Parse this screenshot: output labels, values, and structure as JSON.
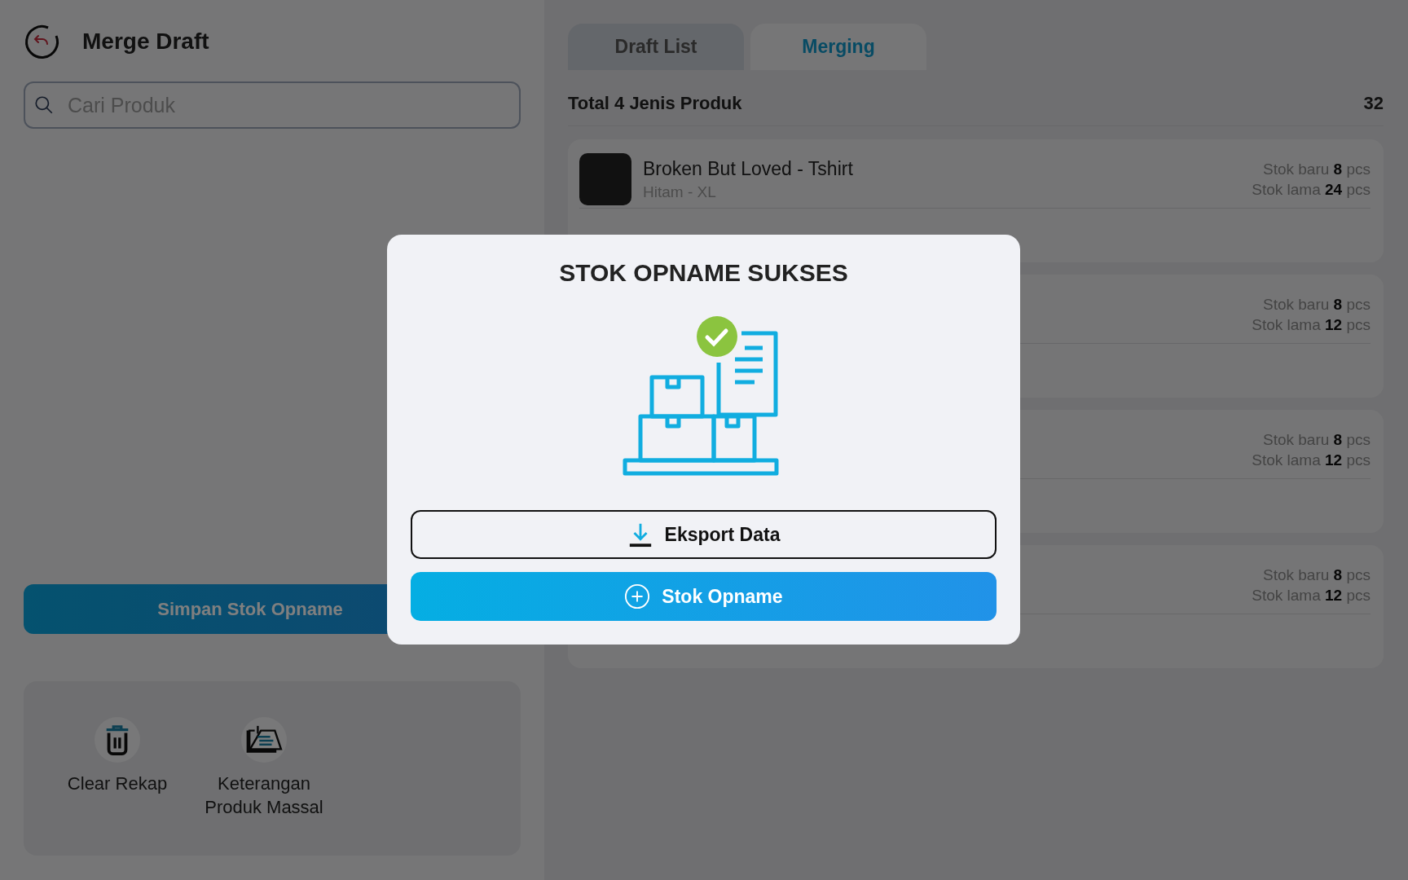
{
  "header": {
    "title": "Merge Draft"
  },
  "search": {
    "placeholder": "Cari Produk"
  },
  "save_button": "Simpan Stok Opname",
  "actions": [
    {
      "kind": "trash",
      "label": "Clear Rekap"
    },
    {
      "kind": "note",
      "label": "Keterangan Produk Massal"
    }
  ],
  "tabs": [
    {
      "label": "Draft List",
      "selected": false
    },
    {
      "label": "Merging",
      "selected": true
    }
  ],
  "summary": {
    "label": "Total 4 Jenis Produk",
    "count": "32"
  },
  "products": [
    {
      "name": "Broken But Loved - Tshirt",
      "variant": "Hitam  - XL",
      "new_stock": "Stok baru **8** pcs",
      "old_stock": "Stok lama **24** pcs"
    },
    {
      "new_stock": "Stok baru **8** pcs",
      "old_stock": "Stok lama **12** pcs"
    },
    {
      "new_stock": "Stok baru **8** pcs",
      "old_stock": "Stok lama **12** pcs"
    },
    {
      "new_stock": "Stok baru **8** pcs",
      "old_stock": "Stok lama **12** pcs"
    }
  ],
  "dialog": {
    "title": "STOK OPNAME SUKSES",
    "export_button": "Eksport Data",
    "opname_button": "Stok Opname"
  }
}
